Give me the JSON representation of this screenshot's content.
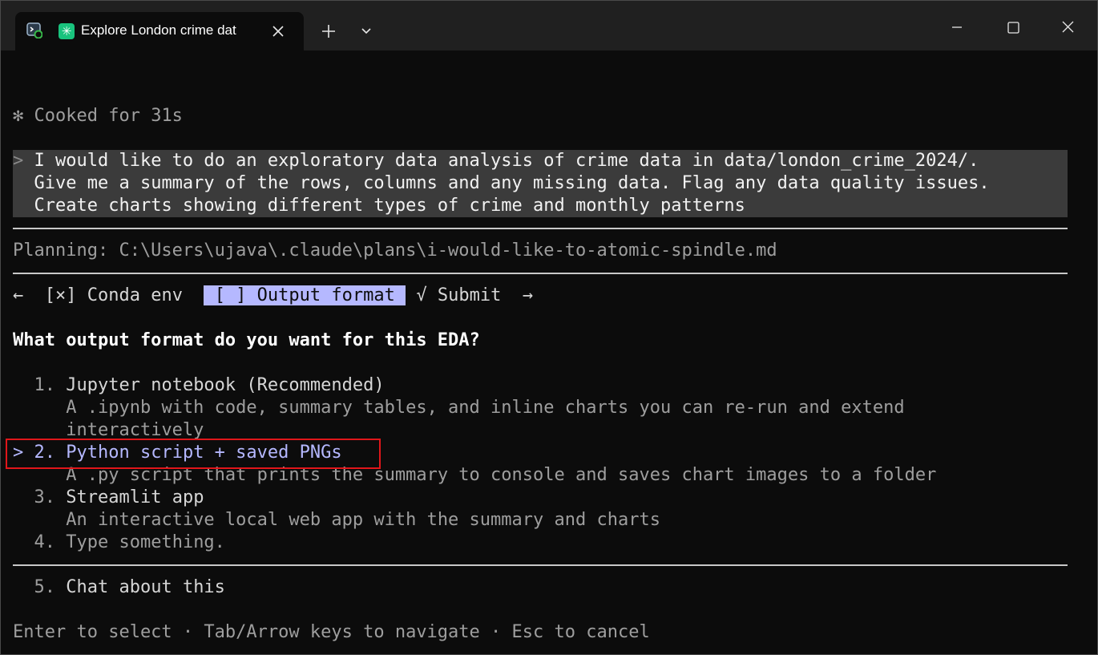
{
  "tab": {
    "title": "Explore London crime dat"
  },
  "header": {
    "status_icon": "✻",
    "status_text": "Cooked for 31s"
  },
  "prompt": {
    "marker": ">",
    "lines": [
      "I would like to do an exploratory data analysis of crime data in data/london_crime_2024/.",
      "Give me a summary of the rows, columns and any missing data. Flag any data quality issues.",
      "Create charts showing different types of crime and monthly patterns"
    ]
  },
  "planning": "Planning: C:\\Users\\ujava\\.claude\\plans\\i-would-like-to-atomic-spindle.md",
  "nav": {
    "left_arrow": "←",
    "step1": "[×] Conda env",
    "step2": "[ ] Output format",
    "step3": "√ Submit",
    "right_arrow": "→"
  },
  "question": "What output format do you want for this EDA?",
  "options": [
    {
      "num": "1.",
      "label": "Jupyter notebook (Recommended)",
      "desc1": "A .ipynb with code, summary tables, and inline charts you can re-run and extend",
      "desc2": "interactively"
    },
    {
      "num": "2.",
      "label": "Python script + saved PNGs",
      "desc1": "A .py script that prints the summary to console and saves chart images to a folder",
      "selected": true
    },
    {
      "num": "3.",
      "label": "Streamlit app",
      "desc1": "An interactive local web app with the summary and charts"
    },
    {
      "num": "4.",
      "label": "Type something."
    }
  ],
  "chat_option": {
    "num": "5.",
    "label": "Chat about this"
  },
  "selected_marker": ">",
  "footer": "Enter to select · Tab/Arrow keys to navigate · Esc to cancel",
  "colors": {
    "accent": "#b5b8ff",
    "highlight_box": "#e0161a",
    "prompt_bg": "#3b3b3b"
  }
}
